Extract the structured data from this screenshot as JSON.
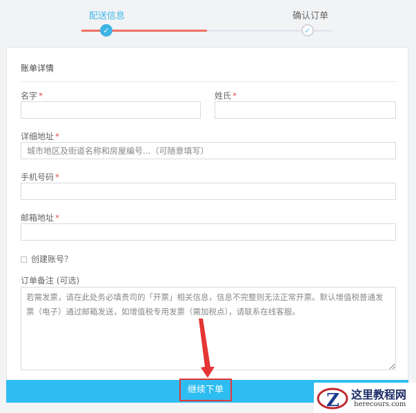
{
  "stepper": {
    "step1_label": "配送信息",
    "step2_label": "确认订单",
    "step1_icon": "check-icon",
    "step2_icon": "check-icon",
    "active_color": "#f07060",
    "accent_color": "#3eb3e4"
  },
  "form": {
    "section_title": "账单详情",
    "first_name": {
      "label": "名字",
      "required": "*",
      "value": ""
    },
    "last_name": {
      "label": "姓氏",
      "required": "*",
      "value": ""
    },
    "address": {
      "label": "详细地址",
      "required": "*",
      "placeholder": "城市地区及街道名称和房屋编号...（可随意填写）"
    },
    "phone": {
      "label": "手机号码",
      "required": "*",
      "value": ""
    },
    "email": {
      "label": "邮箱地址",
      "required": "*",
      "value": ""
    },
    "create_account": {
      "label": "创建账号？",
      "checked": false
    },
    "notes": {
      "label": "订单备注 (可选)",
      "placeholder": "若需发票，请在此处务必填贵司的「开票」相关信息，信息不完整则无法正常开票。默认增值税普通发票（电子）通过邮箱发送，如增值税专用发票（需加税点），请联系在线客服。"
    }
  },
  "submit": {
    "label": "继续下单",
    "bar_color": "#2ebdf1",
    "highlight_color": "#e53535"
  },
  "watermark": {
    "title": "这里教程网",
    "url": "herecours.com"
  }
}
